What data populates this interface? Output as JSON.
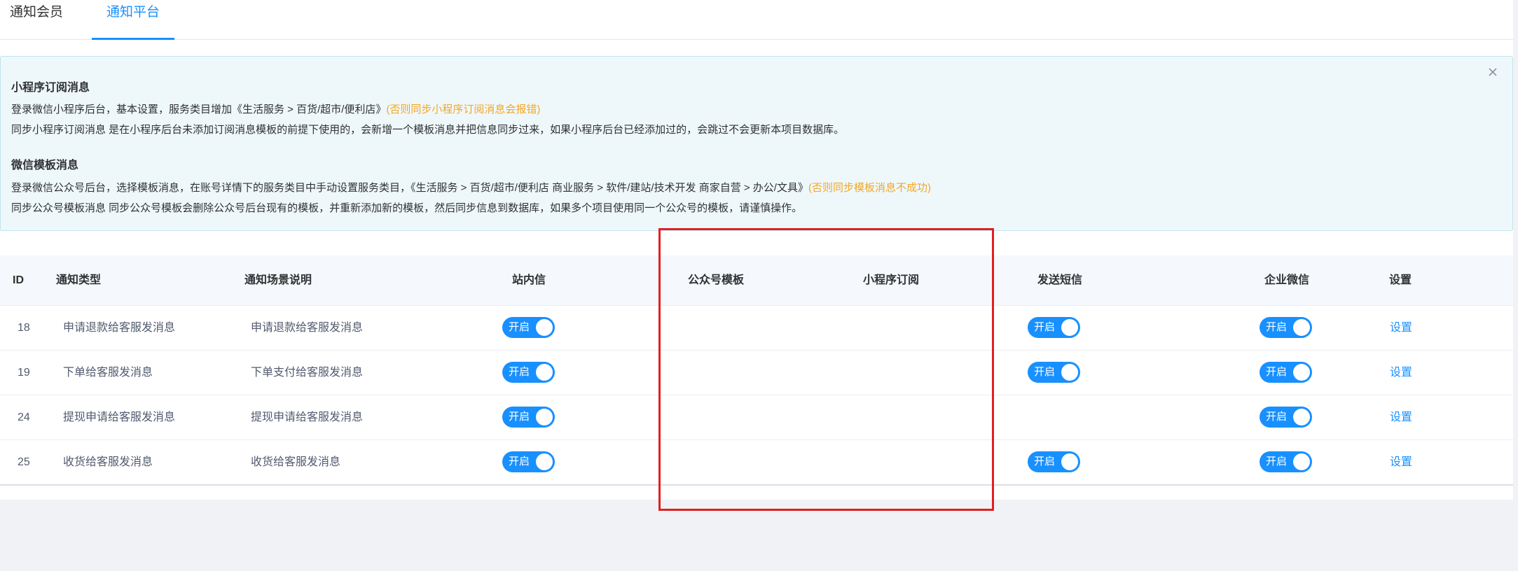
{
  "tabs": [
    {
      "label": "通知会员"
    },
    {
      "label": "通知平台"
    }
  ],
  "alert": {
    "section1_title": "小程序订阅消息",
    "section1_line1": "登录微信小程序后台，基本设置，服务类目增加《生活服务 > 百货/超市/便利店》",
    "section1_line1_warn": "(否则同步小程序订阅消息会报错)",
    "section1_line2": "同步小程序订阅消息 是在小程序后台未添加订阅消息模板的前提下使用的，会新增一个模板消息并把信息同步过来，如果小程序后台已经添加过的，会跳过不会更新本项目数据库。",
    "section2_title": "微信模板消息",
    "section2_line1": "登录微信公众号后台，选择模板消息，在账号详情下的服务类目中手动设置服务类目，《生活服务 > 百货/超市/便利店 商业服务 > 软件/建站/技术开发 商家自营 > 办公/文具》",
    "section2_line1_warn": "(否则同步模板消息不成功)",
    "section2_line2": "同步公众号模板消息 同步公众号模板会删除公众号后台现有的模板，并重新添加新的模板，然后同步信息到数据库，如果多个项目使用同一个公众号的模板，请谨慎操作。"
  },
  "table": {
    "headers": {
      "id": "ID",
      "type": "通知类型",
      "scene": "通知场景说明",
      "site": "站内信",
      "mp_template": "公众号模板",
      "mini_sub": "小程序订阅",
      "sms": "发送短信",
      "work_wechat": "企业微信",
      "settings": "设置"
    },
    "rows": [
      {
        "id": "18",
        "type": "申请退款给客服发消息",
        "scene": "申请退款给客服发消息",
        "site": "开启",
        "sms": "开启",
        "work": "开启",
        "settings": "设置"
      },
      {
        "id": "19",
        "type": "下单给客服发消息",
        "scene": "下单支付给客服发消息",
        "site": "开启",
        "sms": "开启",
        "work": "开启",
        "settings": "设置"
      },
      {
        "id": "24",
        "type": "提现申请给客服发消息",
        "scene": "提现申请给客服发消息",
        "site": "开启",
        "sms": "",
        "work": "开启",
        "settings": "设置"
      },
      {
        "id": "25",
        "type": "收货给客服发消息",
        "scene": "收货给客服发消息",
        "site": "开启",
        "sms": "开启",
        "work": "开启",
        "settings": "设置"
      }
    ]
  },
  "colors": {
    "primary": "#1890ff",
    "warning": "#f5a623",
    "highlight": "#e02020"
  }
}
